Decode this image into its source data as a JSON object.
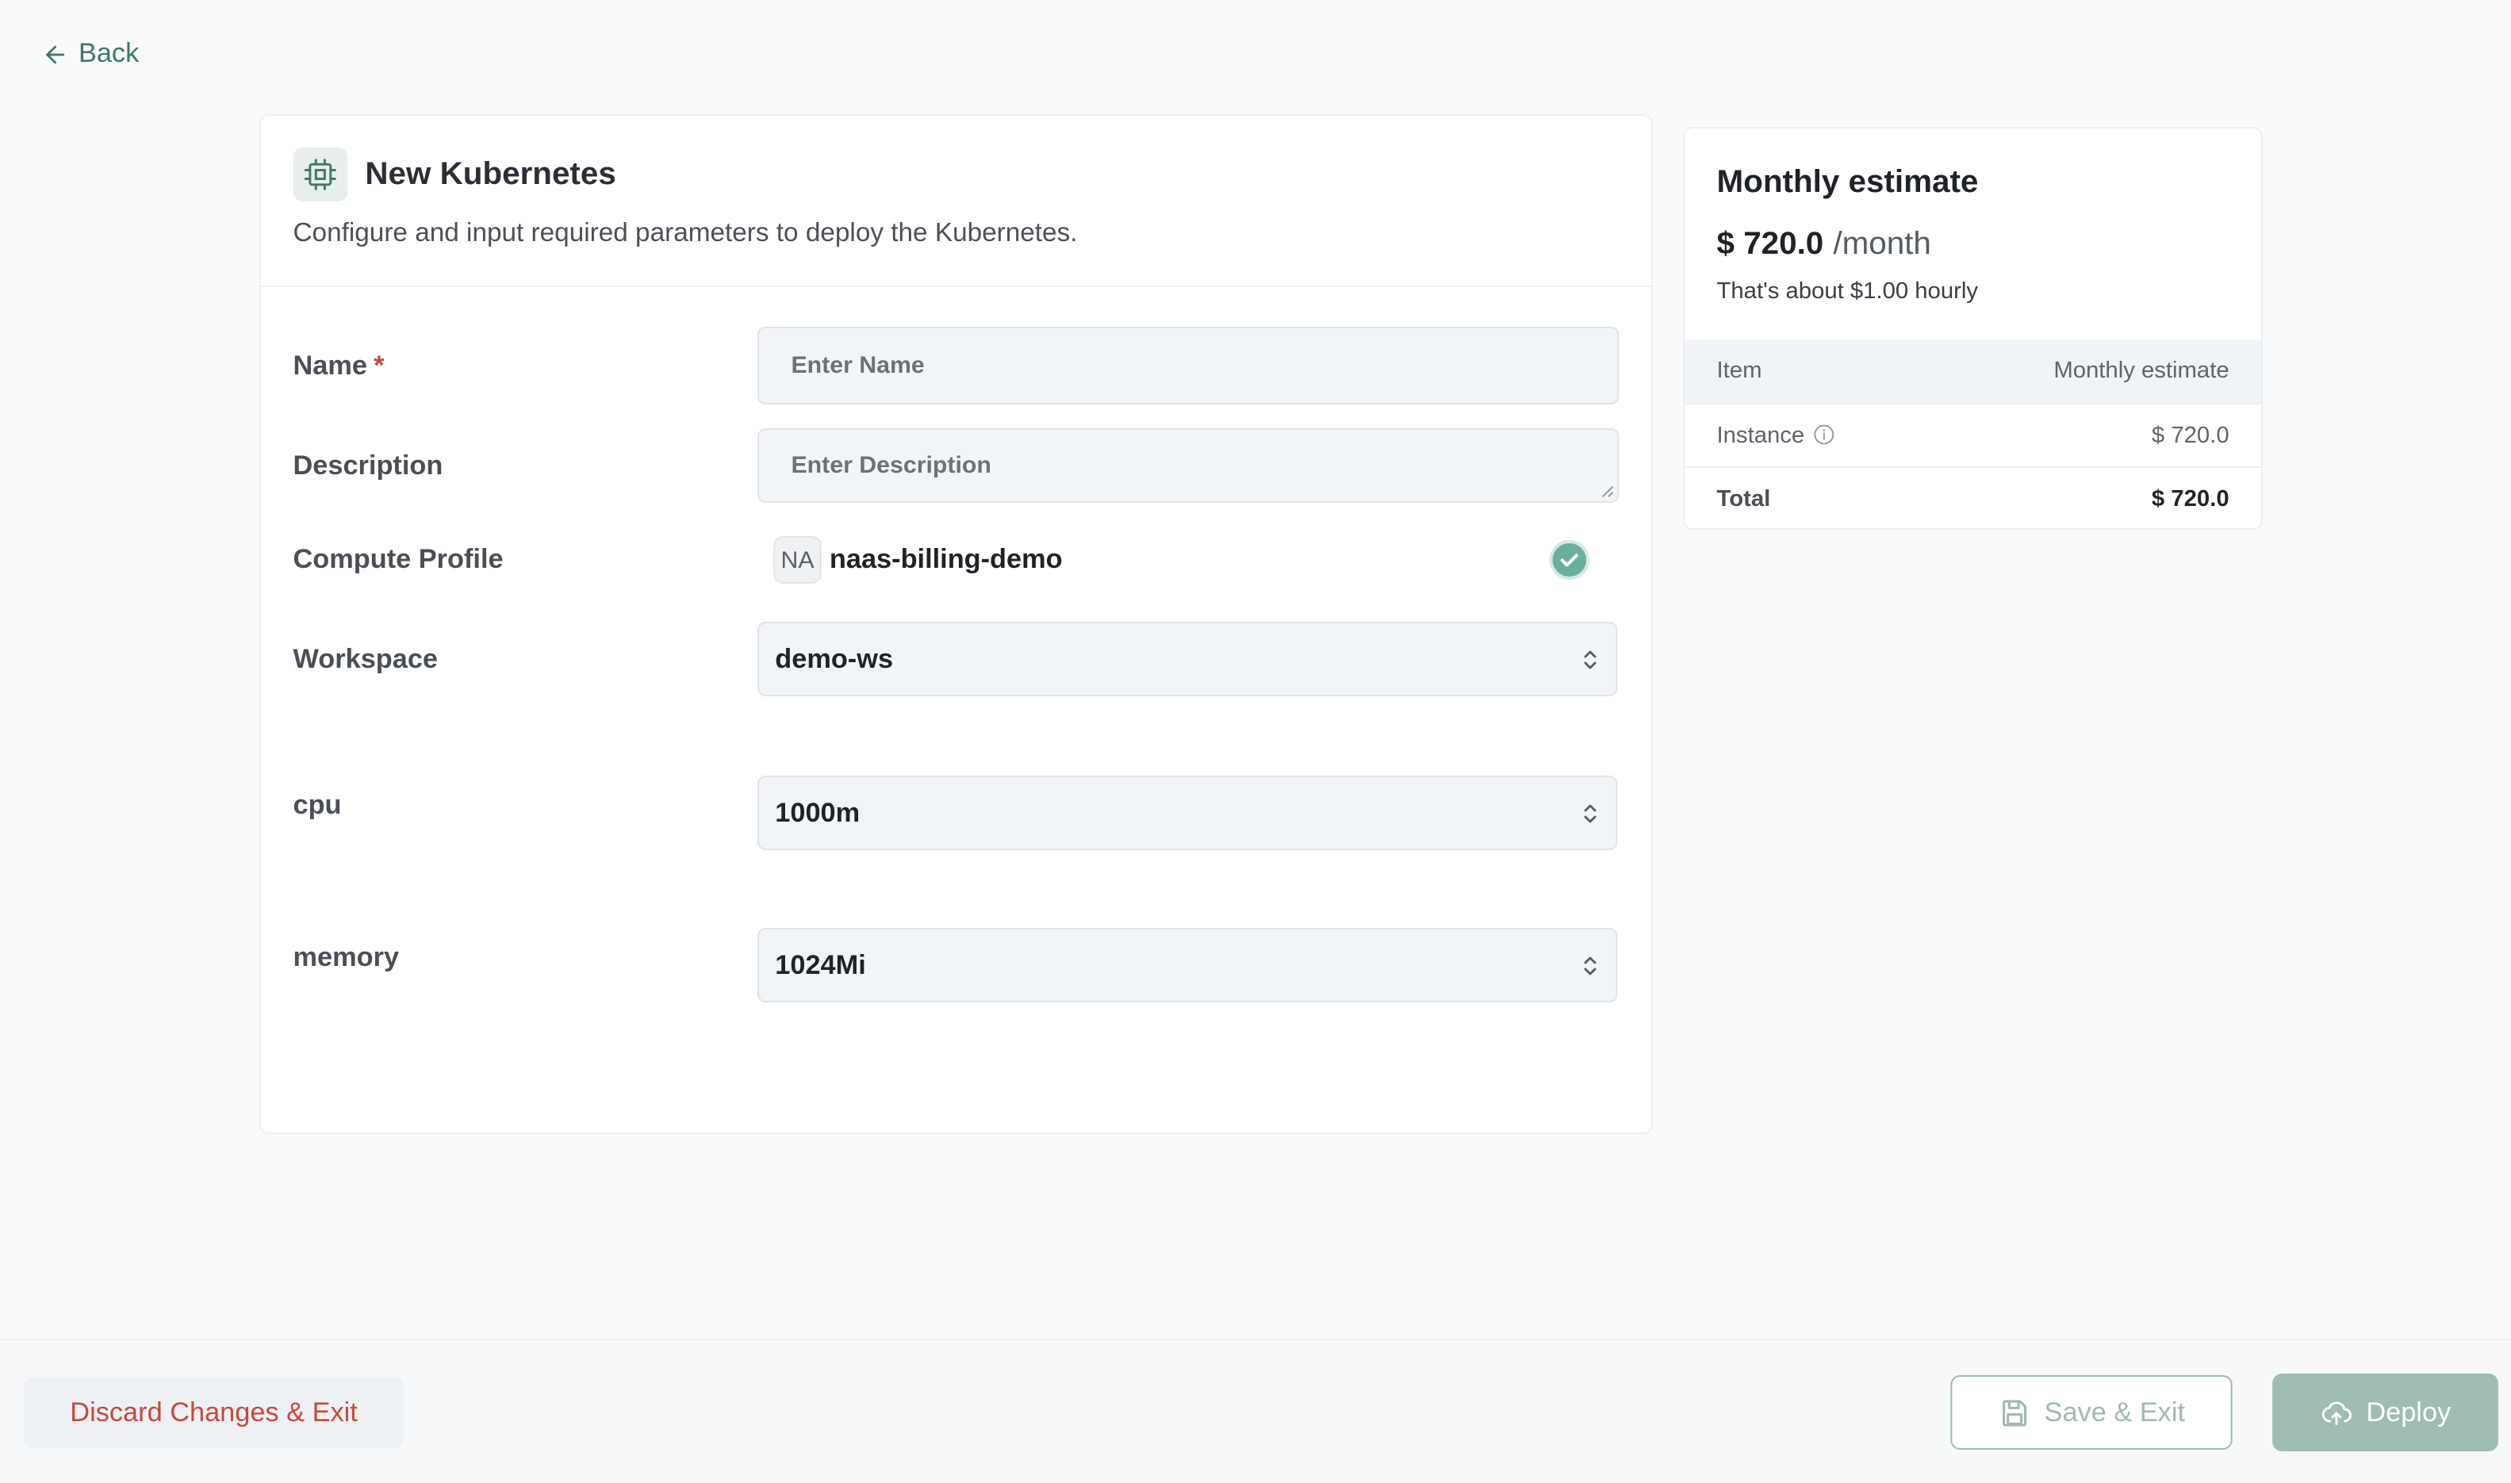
{
  "nav": {
    "back_label": "Back"
  },
  "form": {
    "title": "New Kubernetes",
    "subtitle": "Configure and input required parameters to deploy the Kubernetes.",
    "name": {
      "label": "Name",
      "required_mark": "*",
      "value": "",
      "placeholder": "Enter Name"
    },
    "description": {
      "label": "Description",
      "value": "",
      "placeholder": "Enter Description"
    },
    "compute_profile": {
      "label": "Compute Profile",
      "badge": "NA",
      "value": "naas-billing-demo",
      "selected": true
    },
    "workspace": {
      "label": "Workspace",
      "value": "demo-ws"
    },
    "cpu": {
      "label": "cpu",
      "value": "1000m"
    },
    "memory": {
      "label": "memory",
      "value": "1024Mi"
    }
  },
  "estimate": {
    "title": "Monthly estimate",
    "price": "$ 720.0",
    "period": "/month",
    "hourly_note": "That's about $1.00 hourly",
    "table": {
      "headers": [
        "Item",
        "Monthly estimate"
      ],
      "rows": [
        {
          "item": "Instance",
          "amount": "$ 720.0"
        }
      ],
      "total": {
        "label": "Total",
        "amount": "$ 720.0"
      }
    }
  },
  "footer": {
    "discard_label": "Discard Changes & Exit",
    "save_label": "Save & Exit",
    "deploy_label": "Deploy"
  },
  "colors": {
    "accent": "#3f7a66",
    "danger": "#c9483c",
    "deploy_disabled": "#9fbdb4",
    "check": "#6aaf9d"
  }
}
